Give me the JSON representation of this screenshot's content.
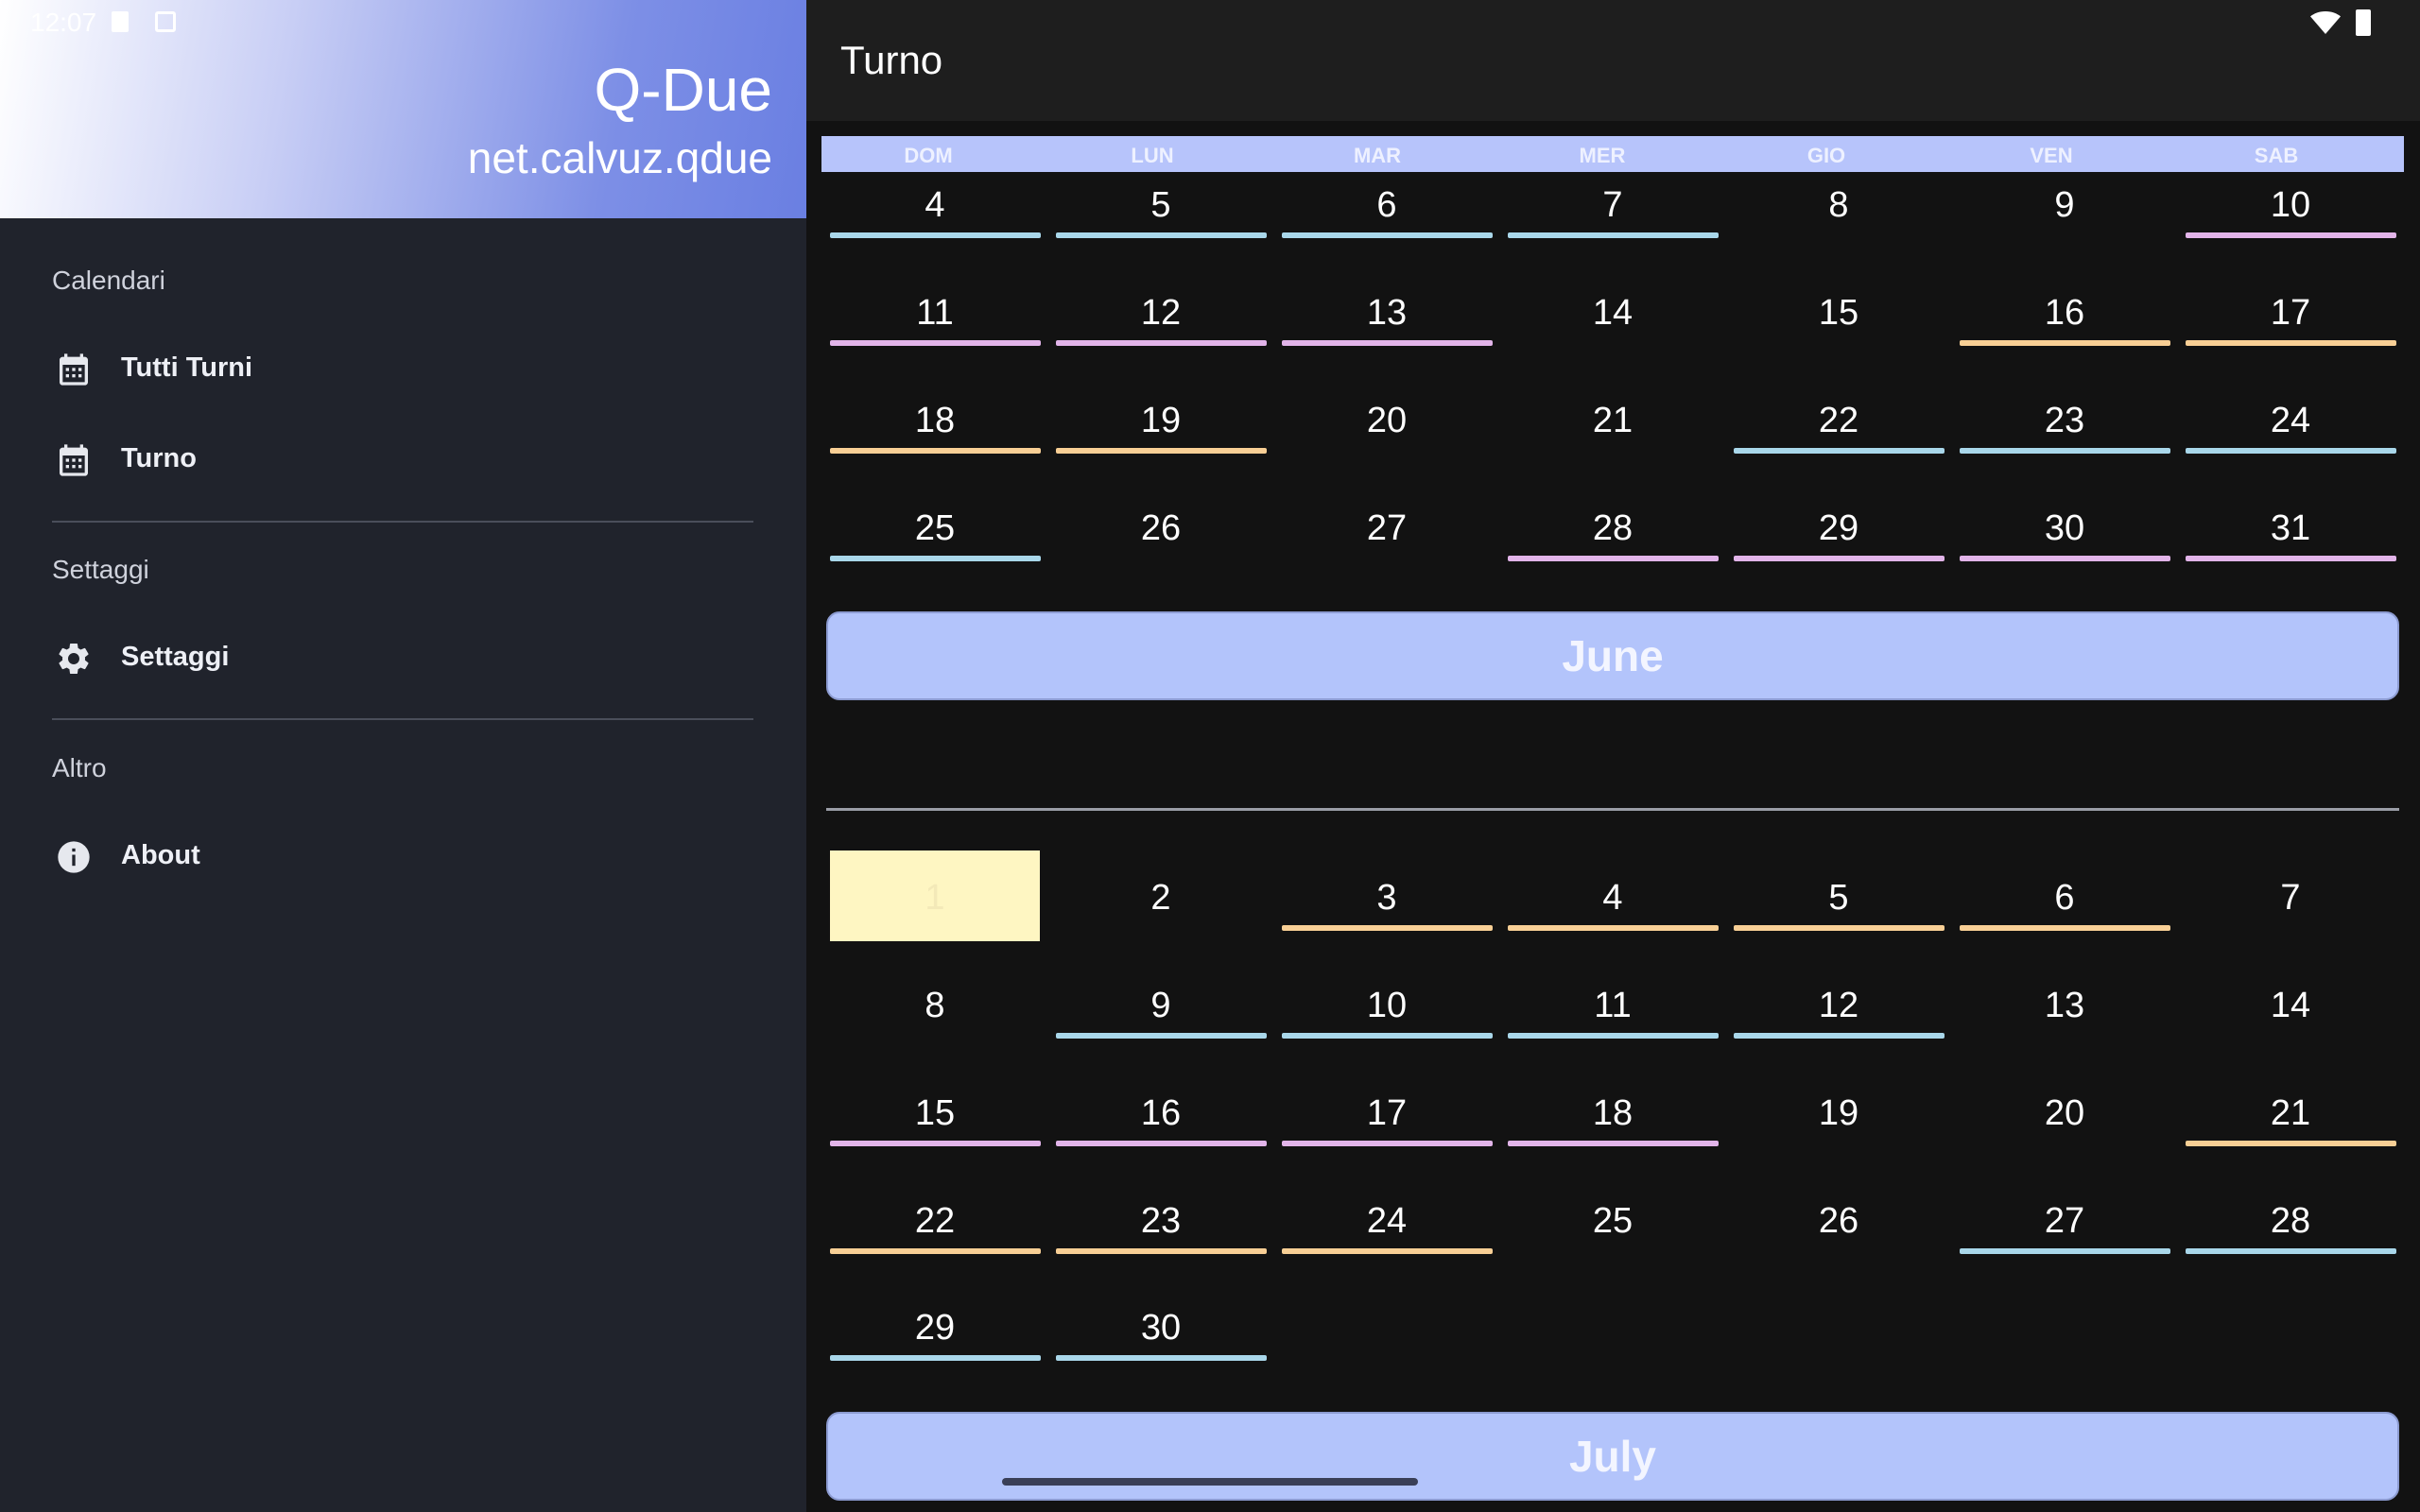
{
  "status_bar": {
    "time": "12:07",
    "icons": [
      "sim-card-icon",
      "a-icon",
      "wifi-icon",
      "battery-icon"
    ]
  },
  "drawer": {
    "app_name": "Q-Due",
    "package": "net.calvuz.qdue",
    "sections": [
      {
        "label": "Calendari",
        "items": [
          {
            "label": "Tutti Turni",
            "icon": "calendar-icon"
          },
          {
            "label": "Turno",
            "icon": "calendar-icon"
          }
        ]
      },
      {
        "label": "Settaggi",
        "items": [
          {
            "label": "Settaggi",
            "icon": "gear-icon"
          }
        ]
      },
      {
        "label": "Altro",
        "items": [
          {
            "label": "About",
            "icon": "info-icon"
          }
        ]
      }
    ]
  },
  "toolbar": {
    "title": "Turno"
  },
  "weekdays": [
    "DOM",
    "LUN",
    "MAR",
    "MER",
    "GIO",
    "VEN",
    "SAB"
  ],
  "colors": {
    "sunday": "#ef5350",
    "shift_blue": "#a9d7ea",
    "shift_pink": "#e2b4e9",
    "shift_orange": "#f8cf95",
    "today": "#fef6c2",
    "month_banner": "#b3c4fb"
  },
  "calendar": {
    "may_tail": [
      [
        {
          "d": "4",
          "s": "b"
        },
        {
          "d": "5",
          "s": "b"
        },
        {
          "d": "6",
          "s": "b"
        },
        {
          "d": "7",
          "s": "b"
        },
        {
          "d": "8",
          "s": ""
        },
        {
          "d": "9",
          "s": ""
        },
        {
          "d": "10",
          "s": "p"
        }
      ],
      [
        {
          "d": "11",
          "s": "p"
        },
        {
          "d": "12",
          "s": "p"
        },
        {
          "d": "13",
          "s": "p"
        },
        {
          "d": "14",
          "s": ""
        },
        {
          "d": "15",
          "s": ""
        },
        {
          "d": "16",
          "s": "o"
        },
        {
          "d": "17",
          "s": "o"
        }
      ],
      [
        {
          "d": "18",
          "s": "o"
        },
        {
          "d": "19",
          "s": "o"
        },
        {
          "d": "20",
          "s": ""
        },
        {
          "d": "21",
          "s": ""
        },
        {
          "d": "22",
          "s": "b"
        },
        {
          "d": "23",
          "s": "b"
        },
        {
          "d": "24",
          "s": "b"
        }
      ],
      [
        {
          "d": "25",
          "s": "b"
        },
        {
          "d": "26",
          "s": ""
        },
        {
          "d": "27",
          "s": ""
        },
        {
          "d": "28",
          "s": "p"
        },
        {
          "d": "29",
          "s": "p"
        },
        {
          "d": "30",
          "s": "p"
        },
        {
          "d": "31",
          "s": "p"
        }
      ]
    ],
    "june_label": "June",
    "june": [
      [
        {
          "d": "1",
          "s": "today"
        },
        {
          "d": "2",
          "s": ""
        },
        {
          "d": "3",
          "s": "o"
        },
        {
          "d": "4",
          "s": "o"
        },
        {
          "d": "5",
          "s": "o"
        },
        {
          "d": "6",
          "s": "o"
        },
        {
          "d": "7",
          "s": ""
        }
      ],
      [
        {
          "d": "8",
          "s": ""
        },
        {
          "d": "9",
          "s": "b"
        },
        {
          "d": "10",
          "s": "b"
        },
        {
          "d": "11",
          "s": "b"
        },
        {
          "d": "12",
          "s": "b"
        },
        {
          "d": "13",
          "s": ""
        },
        {
          "d": "14",
          "s": ""
        }
      ],
      [
        {
          "d": "15",
          "s": "p"
        },
        {
          "d": "16",
          "s": "p"
        },
        {
          "d": "17",
          "s": "p"
        },
        {
          "d": "18",
          "s": "p"
        },
        {
          "d": "19",
          "s": ""
        },
        {
          "d": "20",
          "s": ""
        },
        {
          "d": "21",
          "s": "o"
        }
      ],
      [
        {
          "d": "22",
          "s": "o"
        },
        {
          "d": "23",
          "s": "o"
        },
        {
          "d": "24",
          "s": "o"
        },
        {
          "d": "25",
          "s": ""
        },
        {
          "d": "26",
          "s": ""
        },
        {
          "d": "27",
          "s": "b"
        },
        {
          "d": "28",
          "s": "b"
        }
      ],
      [
        {
          "d": "29",
          "s": "b"
        },
        {
          "d": "30",
          "s": "b"
        }
      ]
    ],
    "july_label": "July"
  }
}
